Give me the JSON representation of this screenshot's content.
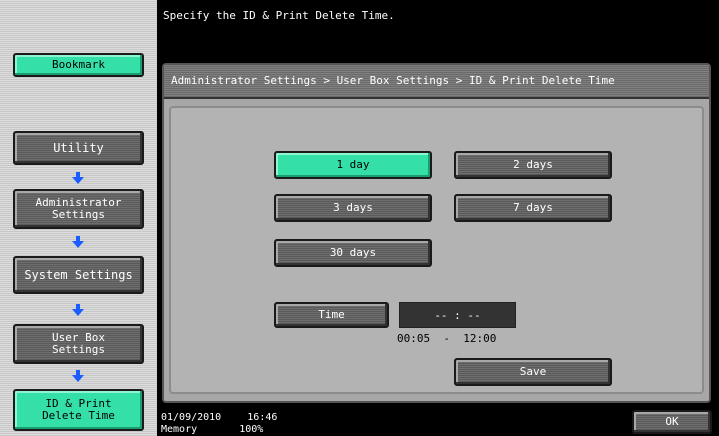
{
  "app": {
    "title": "ID & Print Delete Time"
  },
  "message": "Specify the ID & Print Delete Time.",
  "breadcrumb": "Administrator Settings > User Box Settings > ID & Print Delete Time",
  "left_panel": {
    "bookmark_label": "Bookmark",
    "nav": [
      {
        "label": "Utility",
        "active": false
      },
      {
        "label": "Administrator\nSettings",
        "active": false
      },
      {
        "label": "System Settings",
        "active": false
      },
      {
        "label": "User Box\nSettings",
        "active": false
      },
      {
        "label": "ID & Print\nDelete Time",
        "active": true
      }
    ]
  },
  "options": [
    {
      "label": "1 day",
      "selected": true
    },
    {
      "label": "2 days",
      "selected": false
    },
    {
      "label": "3 days",
      "selected": false
    },
    {
      "label": "7 days",
      "selected": false
    },
    {
      "label": "30 days",
      "selected": false
    }
  ],
  "time": {
    "button_label": "Time",
    "value": "-- : --",
    "range": "00:05  -  12:00"
  },
  "save_label": "Save",
  "ok_label": "OK",
  "status": {
    "date": "01/09/2010",
    "time": "16:46",
    "memory_label": "Memory",
    "memory_value": "100%"
  },
  "colors": {
    "selected": "#34e0a8",
    "button_gray": "#5a5a5a",
    "arrow_blue": "#1a5cff"
  }
}
